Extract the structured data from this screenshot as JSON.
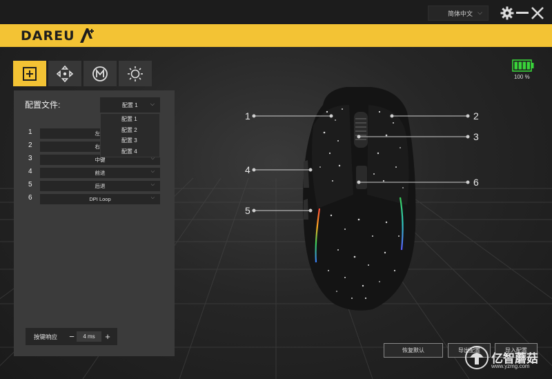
{
  "titlebar": {
    "language": "简体中文",
    "icons": [
      "gear-icon",
      "minimize-icon",
      "close-icon"
    ]
  },
  "brand": {
    "logo_text": "DAREU",
    "accent_color": "#f3c334"
  },
  "tabs": [
    {
      "name": "button-settings",
      "icon": "plus-square-icon",
      "active": true
    },
    {
      "name": "dpi-settings",
      "icon": "move-arrows-icon",
      "active": false
    },
    {
      "name": "macro-settings",
      "icon": "m-circle-icon",
      "active": false
    },
    {
      "name": "lighting-settings",
      "icon": "sun-icon",
      "active": false
    }
  ],
  "battery": {
    "percent_text": "100 %",
    "level": 1.0,
    "color": "#39d43a"
  },
  "profile": {
    "label": "配置文件:",
    "selected": "配置 1",
    "options": [
      "配置 1",
      "配置 2",
      "配置 3",
      "配置 4"
    ]
  },
  "keys": [
    {
      "num": "1",
      "value": "左键"
    },
    {
      "num": "2",
      "value": "右键"
    },
    {
      "num": "3",
      "value": "中键"
    },
    {
      "num": "4",
      "value": "前进"
    },
    {
      "num": "5",
      "value": "后退"
    },
    {
      "num": "6",
      "value": "DPI Loop"
    }
  ],
  "response": {
    "label": "按键响应",
    "value": "4 ms",
    "minus": "−",
    "plus": "+"
  },
  "buttons": {
    "restore": "恢复默认",
    "export": "导出配置",
    "import": "导入配置"
  },
  "callouts": [
    "1",
    "2",
    "3",
    "4",
    "5",
    "6"
  ],
  "watermark": {
    "text": "亿智蘑菇",
    "url": "www.yzmg.com"
  }
}
